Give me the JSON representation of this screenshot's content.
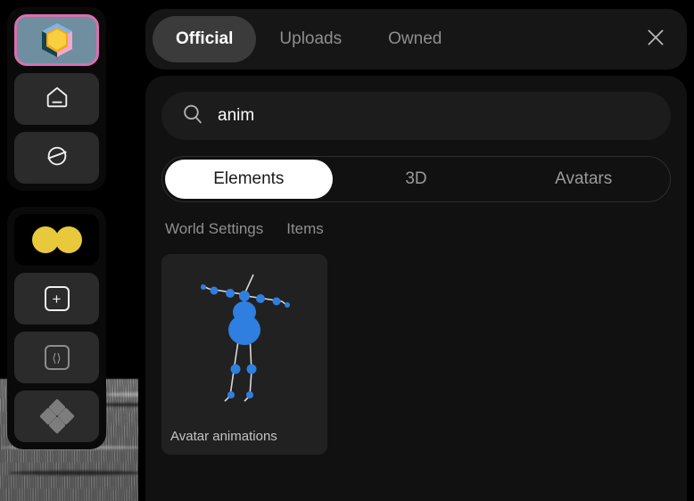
{
  "app": {
    "background_color": "#000000",
    "panel_color": "#111111"
  },
  "sidebar": {
    "groups": [
      {
        "name": "top-rail",
        "items": [
          {
            "id": "logo",
            "icon": "cube-logo-icon",
            "label": "",
            "active": true,
            "accent": "#d96fae"
          },
          {
            "id": "home",
            "icon": "home-icon",
            "label": "",
            "active": false
          },
          {
            "id": "world",
            "icon": "planet-icon",
            "label": "",
            "active": false
          }
        ]
      },
      {
        "name": "bottom-rail",
        "items": [
          {
            "id": "avatar",
            "icon": "two-circles-icon",
            "label": "",
            "active": false,
            "accent": "#e8c93c"
          },
          {
            "id": "add",
            "icon": "plus-square-icon",
            "label": "",
            "active": false
          },
          {
            "id": "code",
            "icon": "code-brackets-icon",
            "label": "",
            "active": false
          },
          {
            "id": "assets",
            "icon": "four-diamonds-icon",
            "label": "",
            "active": false
          }
        ]
      }
    ]
  },
  "header": {
    "tabs": [
      {
        "label": "Official",
        "active": true
      },
      {
        "label": "Uploads",
        "active": false
      },
      {
        "label": "Owned",
        "active": false
      }
    ],
    "close_icon": "close-icon"
  },
  "search": {
    "icon": "search-icon",
    "value": "anim",
    "placeholder": "Search"
  },
  "segmented": {
    "options": [
      {
        "label": "Elements",
        "active": true
      },
      {
        "label": "3D",
        "active": false
      },
      {
        "label": "Avatars",
        "active": false
      }
    ]
  },
  "categories": [
    {
      "label": "World Settings",
      "active": false
    },
    {
      "label": "Items",
      "active": false
    }
  ],
  "results": {
    "items": [
      {
        "label": "Avatar animations",
        "thumbnail": "avatar-skeleton-rig"
      }
    ]
  }
}
